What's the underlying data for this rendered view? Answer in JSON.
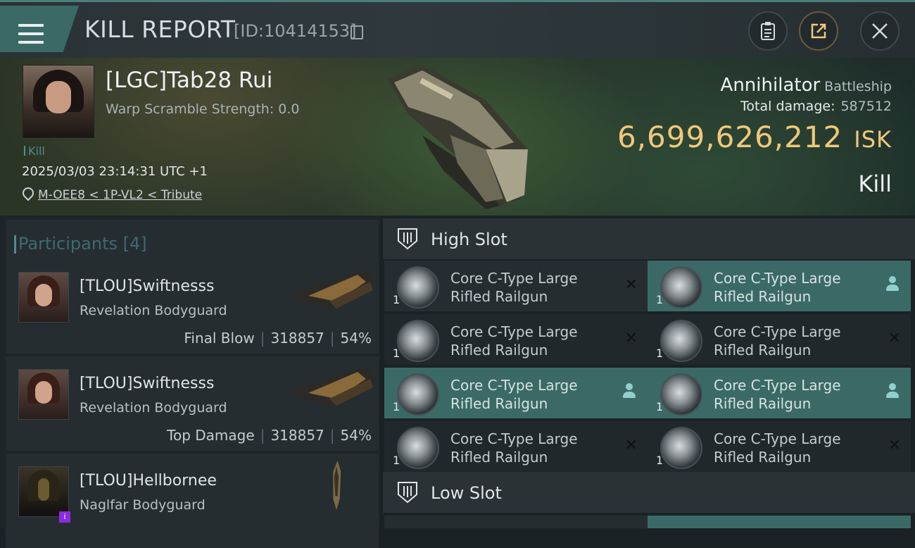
{
  "header": {
    "title": "KILL REPORT",
    "report_id": "[ID:10414153]"
  },
  "victim": {
    "name": "[LGC]Tab28 Rui",
    "warp_scramble": "Warp Scramble Strength: 0.0",
    "kill_tag": "Kill",
    "timestamp": "2025/03/03 23:14:31 UTC +1",
    "location": "M-OEE8 < 1P-VL2 < Tribute",
    "ship_name": "Annihilator",
    "ship_class": "Battleship",
    "total_damage_label": "Total damage:",
    "total_damage": "587512",
    "isk_value": "6,699,626,212",
    "isk_unit": "ISK",
    "result": "Kill"
  },
  "participants": {
    "title": "Participants",
    "count": "[4]",
    "rows": [
      {
        "name": "[TLOU]Swiftnesss",
        "ship": "Revelation Bodyguard",
        "role": "Final Blow",
        "damage": "318857",
        "percent": "54%"
      },
      {
        "name": "[TLOU]Swiftnesss",
        "ship": "Revelation Bodyguard",
        "role": "Top Damage",
        "damage": "318857",
        "percent": "54%"
      },
      {
        "name": "[TLOU]Hellbornee",
        "ship": "Naglfar Bodyguard",
        "role": "",
        "damage": "",
        "percent": ""
      }
    ]
  },
  "slots": {
    "high": {
      "title": "High Slot",
      "modules": [
        {
          "line1": "Core C-Type Large",
          "line2": "Rifled Railgun",
          "qty": "1",
          "status": "destroyed",
          "highlight": false
        },
        {
          "line1": "Core C-Type Large",
          "line2": "Rifled Railgun",
          "qty": "1",
          "status": "dropped",
          "highlight": true
        },
        {
          "line1": "Core C-Type Large",
          "line2": "Rifled Railgun",
          "qty": "1",
          "status": "destroyed",
          "highlight": false
        },
        {
          "line1": "Core C-Type Large",
          "line2": "Rifled Railgun",
          "qty": "1",
          "status": "destroyed",
          "highlight": false
        },
        {
          "line1": "Core C-Type Large",
          "line2": "Rifled Railgun",
          "qty": "1",
          "status": "dropped",
          "highlight": true
        },
        {
          "line1": "Core C-Type Large",
          "line2": "Rifled Railgun",
          "qty": "1",
          "status": "dropped",
          "highlight": true
        },
        {
          "line1": "Core C-Type Large",
          "line2": "Rifled Railgun",
          "qty": "1",
          "status": "destroyed",
          "highlight": false
        },
        {
          "line1": "Core C-Type Large",
          "line2": "Rifled Railgun",
          "qty": "1",
          "status": "destroyed",
          "highlight": false
        }
      ]
    },
    "low": {
      "title": "Low Slot"
    }
  },
  "icons": {
    "menu": "menu-icon",
    "copy": "copy-icon",
    "clipboard": "clipboard-icon",
    "share": "share-icon",
    "close": "close-icon",
    "location": "location-pin-icon",
    "destroyed": "x-icon",
    "dropped": "person-icon"
  },
  "colors": {
    "accent": "#3b6a66",
    "isk": "#f0c87a",
    "kill_tag": "#4c8f8a"
  }
}
